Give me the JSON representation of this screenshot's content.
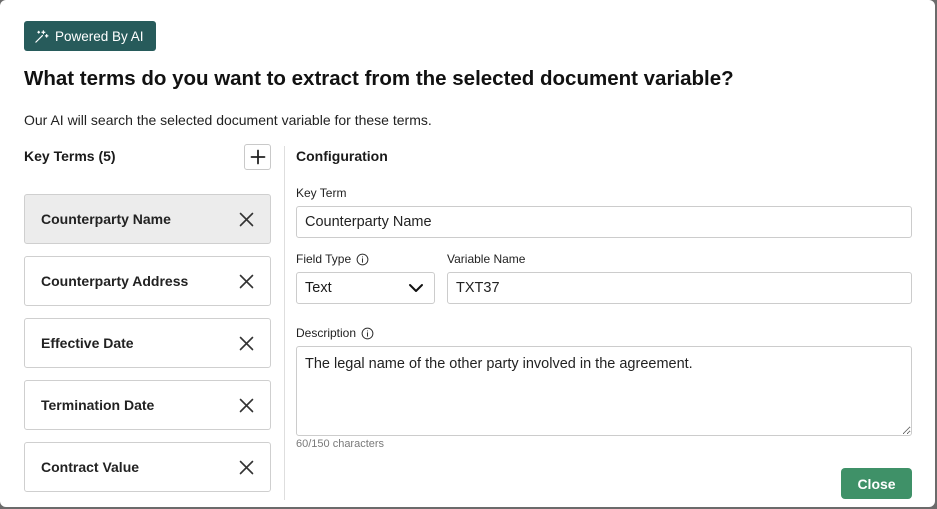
{
  "badge": {
    "label": "Powered By AI",
    "icon": "sparkles-icon"
  },
  "dialog": {
    "title": "What terms do you want to extract from the selected document variable?",
    "subtitle": "Our AI will search the selected document variable for these terms."
  },
  "key_terms": {
    "header": "Key Terms (5)",
    "add_icon": "plus-icon",
    "items": [
      {
        "label": "Counterparty Name",
        "selected": true
      },
      {
        "label": "Counterparty Address",
        "selected": false
      },
      {
        "label": "Effective Date",
        "selected": false
      },
      {
        "label": "Termination Date",
        "selected": false
      },
      {
        "label": "Contract Value",
        "selected": false
      }
    ]
  },
  "configuration": {
    "header": "Configuration",
    "key_term_label": "Key Term",
    "key_term_value": "Counterparty Name",
    "field_type_label": "Field Type",
    "field_type_value": "Text",
    "variable_name_label": "Variable Name",
    "variable_name_value": "TXT37",
    "description_label": "Description",
    "description_value": "The legal name of the other party involved in the agreement.",
    "char_count": "60/150 characters"
  },
  "actions": {
    "close_label": "Close"
  },
  "colors": {
    "badge_bg": "#275b5b",
    "close_bg": "#3f9168",
    "selected_bg": "#ececec"
  }
}
